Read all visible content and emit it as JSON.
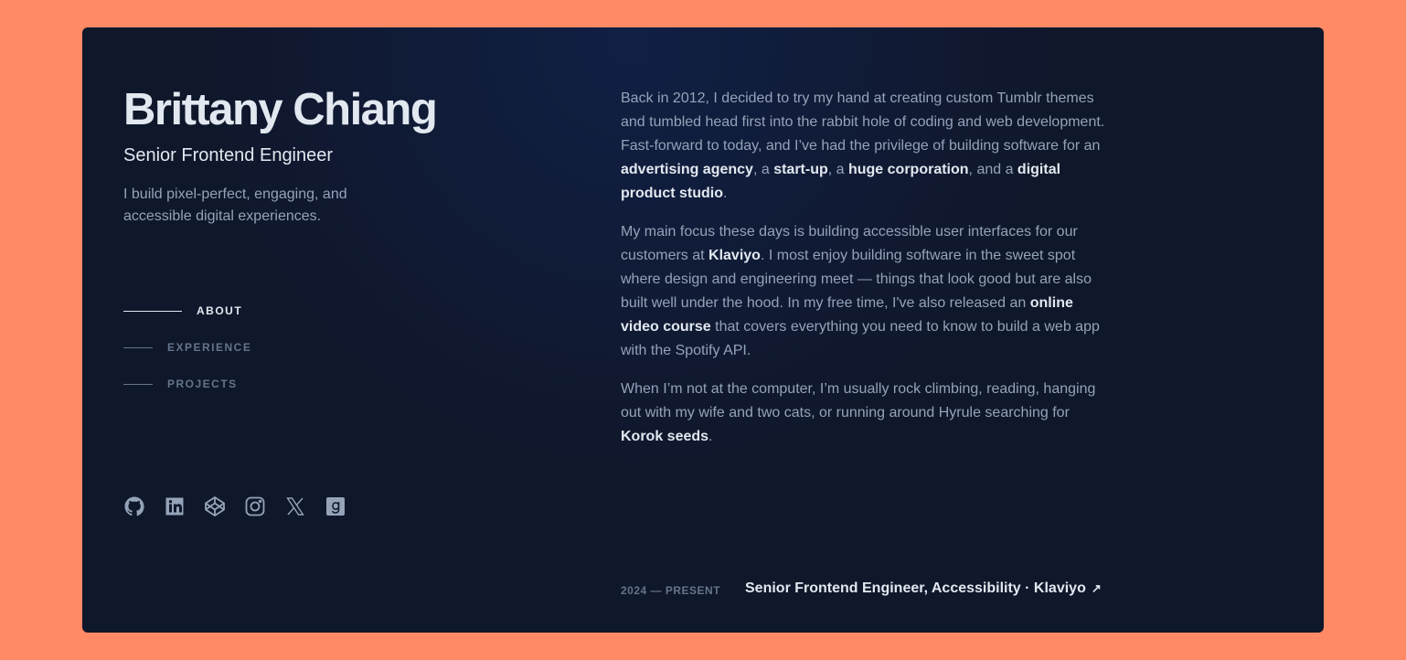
{
  "header": {
    "name": "Brittany Chiang",
    "role": "Senior Frontend Engineer",
    "tagline": "I build pixel-perfect, engaging, and accessible digital experiences."
  },
  "nav": {
    "items": [
      {
        "label": "ABOUT",
        "active": true
      },
      {
        "label": "EXPERIENCE",
        "active": false
      },
      {
        "label": "PROJECTS",
        "active": false
      }
    ]
  },
  "socials": [
    {
      "icon": "github-icon"
    },
    {
      "icon": "linkedin-icon"
    },
    {
      "icon": "codepen-icon"
    },
    {
      "icon": "instagram-icon"
    },
    {
      "icon": "x-icon"
    },
    {
      "icon": "goodreads-icon"
    }
  ],
  "about": {
    "p1": {
      "t1": "Back in 2012, I decided to try my hand at creating custom Tumblr themes and tumbled head first into the rabbit hole of coding and web development. Fast-forward to today, and I’ve had the privilege of building software for an ",
      "l1": "advertising agency",
      "t2": ", a ",
      "l2": "start-up",
      "t3": ", a ",
      "l3": "huge corporation",
      "t4": ", and a ",
      "l4": "digital product studio",
      "t5": "."
    },
    "p2": {
      "t1": "My main focus these days is building accessible user interfaces for our customers at ",
      "l1": "Klaviyo",
      "t2": ". I most enjoy building software in the sweet spot where design and engineering meet — things that look good but are also built well under the hood. In my free time, I've also released an ",
      "l2": "online video course",
      "t3": " that covers everything you need to know to build a web app with the Spotify API."
    },
    "p3": {
      "t1": "When I’m not at the computer, I’m usually rock climbing, reading, hanging out with my wife and two cats, or running around Hyrule searching for ",
      "l1": "Korok seeds",
      "t2": "."
    }
  },
  "experience": {
    "date": "2024 — PRESENT",
    "title": "Senior Frontend Engineer, Accessibility · Klaviyo",
    "arrow": "↗"
  },
  "colors": {
    "background": "#0f172a",
    "outer": "#ff8a65",
    "heading": "#e2e8f0",
    "body": "#94a3b8",
    "muted": "#64748b"
  }
}
